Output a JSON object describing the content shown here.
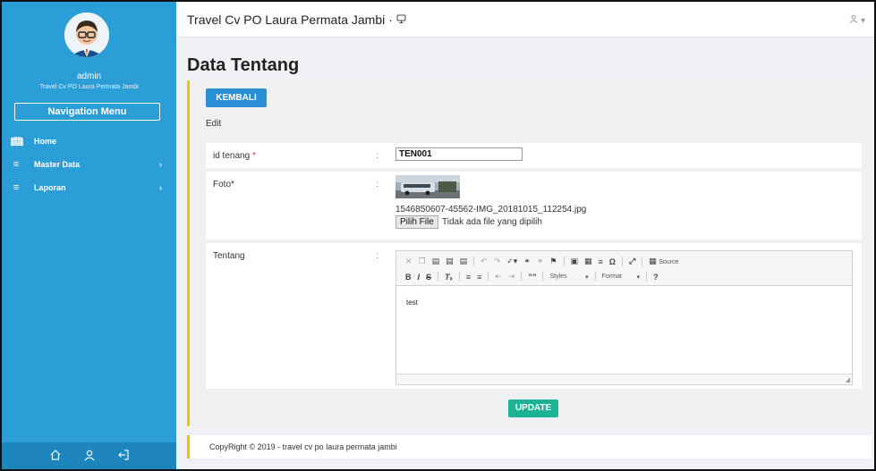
{
  "sidebar": {
    "user_name": "admin",
    "user_org": "Travel Cv PO Laura Permata Jambi",
    "nav_menu_label": "Navigation Menu",
    "items": [
      {
        "label": "Home",
        "icon": "book-icon"
      },
      {
        "label": "Master Data",
        "icon": "list-icon",
        "chevron": "›"
      },
      {
        "label": "Laporan",
        "icon": "list-icon",
        "chevron": "›"
      }
    ],
    "footer_icons": [
      "home-icon",
      "user-icon",
      "logout-icon"
    ]
  },
  "topbar": {
    "title": "Travel Cv PO Laura Permata Jambi ·",
    "user_menu_icon": "user-icon"
  },
  "page": {
    "title": "Data Tentang",
    "back_label": "KEMBALI",
    "edit_label": "Edit"
  },
  "form": {
    "id_field": {
      "label": "id tenang",
      "required_mark": "*",
      "value": "TEN001"
    },
    "photo_field": {
      "label": "Foto*",
      "file_name": "1546850607-45562-IMG_20181015_112254.jpg",
      "file_button": "Pilih File",
      "file_status": "Tidak ada file yang dipilih"
    },
    "about_field": {
      "label": "Tentang",
      "content": "test",
      "toolbar": {
        "source_label": "Source",
        "styles_label": "Styles",
        "format_label": "Format",
        "help_label": "?"
      }
    },
    "colon": ":",
    "update_label": "UPDATE"
  },
  "footer": {
    "text": "CopyRight © 2019 - travel cv po laura permata jambi"
  },
  "colors": {
    "sidebar": "#2b9ed8",
    "primary_button": "#2b8fd6",
    "success_button": "#1ab394",
    "accent_border": "#f2c200",
    "background": "#f0f1f4"
  }
}
